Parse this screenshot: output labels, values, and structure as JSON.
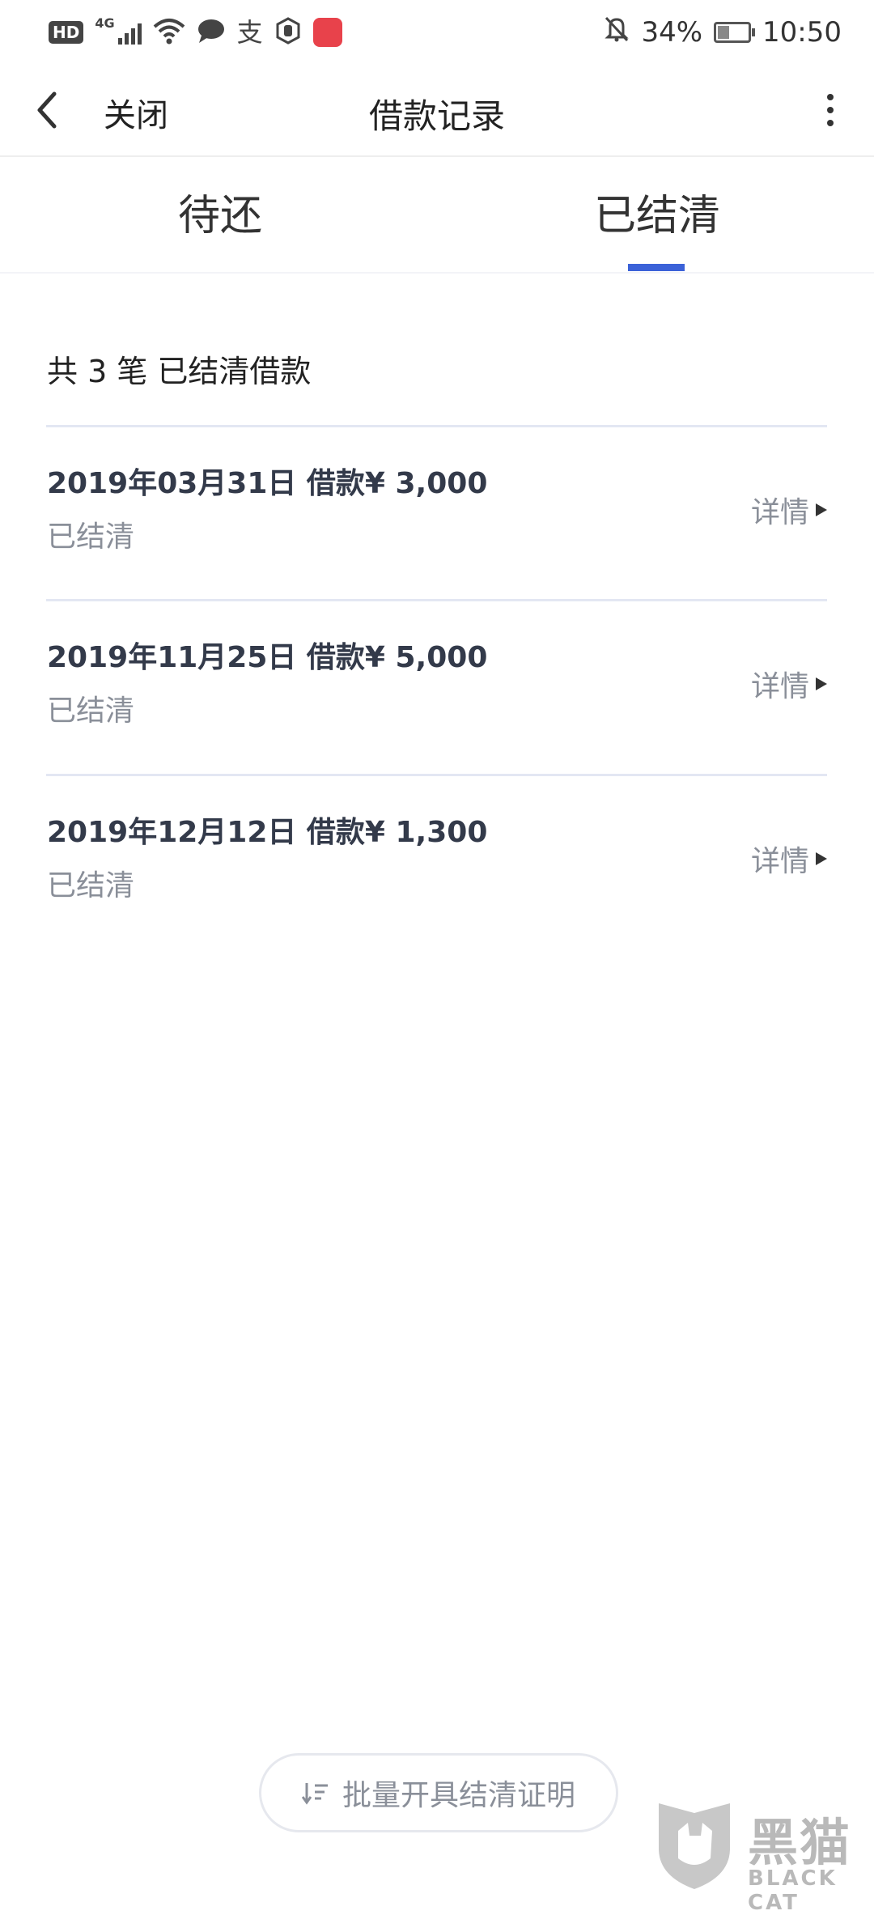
{
  "status_bar": {
    "hd": "HD",
    "network": "4G",
    "battery_percent": "34%",
    "battery_level": 0.34,
    "time": "10:50",
    "icons": [
      "hd-icon",
      "signal-icon",
      "wifi-icon",
      "message-icon",
      "alipay-icon",
      "hand-icon",
      "app-store-icon",
      "mute-bell-icon",
      "battery-icon"
    ]
  },
  "nav": {
    "back_icon": "chevron-left-icon",
    "close_label": "关闭",
    "title": "借款记录",
    "more_icon": "more-vertical-icon"
  },
  "tabs": [
    {
      "label": "待还",
      "active": false
    },
    {
      "label": "已结清",
      "active": true
    }
  ],
  "accent_color": "#3b62d8",
  "summary": "共 3 笔 已结清借款",
  "loans": [
    {
      "title": "2019年03月31日 借款¥ 3,000",
      "status": "已结清",
      "detail": "详情"
    },
    {
      "title": "2019年11月25日 借款¥ 5,000",
      "status": "已结清",
      "detail": "详情"
    },
    {
      "title": "2019年12月12日 借款¥ 1,300",
      "status": "已结清",
      "detail": "详情"
    }
  ],
  "batch_button": {
    "label": "批量开具结清证明",
    "icon": "sort-icon"
  },
  "watermark": {
    "cn": "黑猫",
    "en": "BLACK CAT"
  }
}
